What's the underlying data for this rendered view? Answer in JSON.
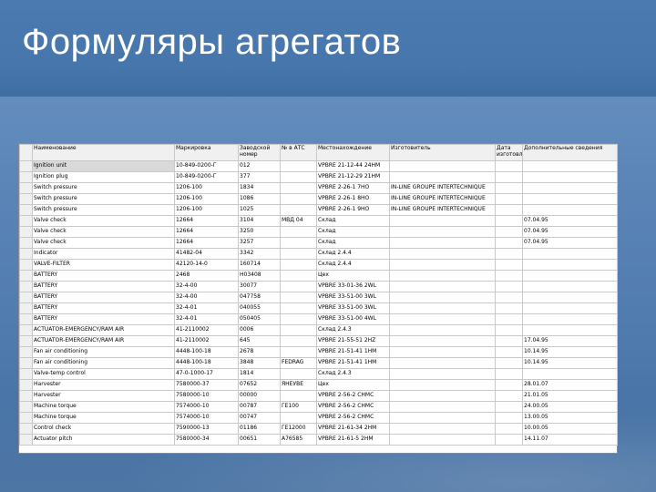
{
  "slide": {
    "title": "Формуляры агрегатов"
  },
  "table": {
    "headers": [
      "Наименование",
      "Маркировка",
      "Заводской номер",
      "№ в АТС",
      "Местонахождение",
      "Изготовитель",
      "Дата изготовления",
      "Дополнительные сведения"
    ],
    "rows": [
      [
        "Ignition unit",
        "10-849-0200-Г",
        "012",
        "",
        "VPBRE 21-12-44 24HM",
        "",
        "",
        ""
      ],
      [
        "Ignition plug",
        "10-849-0200-Г",
        "377",
        "",
        "VPBRE 21-12-29 21HM",
        "",
        "",
        ""
      ],
      [
        "Switch pressure",
        "1206-100",
        "1834",
        "",
        "VPBRE 2-26-1 7HO",
        "IN-LINE GROUPE INTERTECHNIQUE",
        "",
        ""
      ],
      [
        "Switch pressure",
        "1206-100",
        "1086",
        "",
        "VPBRE 2-26-1 8HO",
        "IN-LINE GROUPE INTERTECHNIQUE",
        "",
        ""
      ],
      [
        "Switch pressure",
        "1206-100",
        "1025",
        "",
        "VPBRE 2-26-1 9HO",
        "IN-LINE GROUPE INTERTECHNIQUE",
        "",
        ""
      ],
      [
        "Valve check",
        "12664",
        "3104",
        "МВД 04",
        "Склад",
        "",
        "",
        "07.04.95"
      ],
      [
        "Valve check",
        "12664",
        "3250",
        "",
        "Склад",
        "",
        "",
        "07.04.95"
      ],
      [
        "Valve check",
        "12664",
        "3257",
        "",
        "Склад",
        "",
        "",
        "07.04.95"
      ],
      [
        "Indicator",
        "41482-04",
        "3342",
        "",
        "Склад 2.4.4",
        "",
        "",
        ""
      ],
      [
        "VALVE-FILTER",
        "42120-14-0",
        "160714",
        "",
        "Склад 2.4.4",
        "",
        "",
        ""
      ],
      [
        "BATTERY",
        "2468",
        "H03408",
        "",
        "Цех",
        "",
        "",
        ""
      ],
      [
        "BATTERY",
        "32-4-00",
        "30077",
        "",
        "VPBRE 33-01-36 2WL",
        "",
        "",
        ""
      ],
      [
        "BATTERY",
        "32-4-00",
        "047758",
        "",
        "VPBRE 33-51-00 3WL",
        "",
        "",
        ""
      ],
      [
        "BATTERY",
        "32-4-01",
        "040055",
        "",
        "VPBRE 33-51-00 3WL",
        "",
        "",
        ""
      ],
      [
        "BATTERY",
        "32-4-01",
        "050405",
        "",
        "VPBRE 33-51-00 4WL",
        "",
        "",
        ""
      ],
      [
        "ACTUATOR-EMERGENCY/RAM AIR",
        "41-2110002",
        "0006",
        "",
        "Склад 2.4.3",
        "",
        "",
        ""
      ],
      [
        "ACTUATOR-EMERGENCY/RAM AIR",
        "41-2110002",
        "645",
        "",
        "VPBRE 21-55-51 2HZ",
        "",
        "",
        "17.04.95"
      ],
      [
        "Fan air conditioning",
        "4448-100-18",
        "2678",
        "",
        "VPBRE 21-51-41 1HM",
        "",
        "",
        "10.14.95"
      ],
      [
        "Fan air conditioning",
        "4448-100-18",
        "3848",
        "FEDRAG",
        "VPBRE 21-51-41 1HM",
        "",
        "",
        "10.14.95"
      ],
      [
        "Valve-temp control",
        "47-0-1000-17",
        "1814",
        "",
        "Склад 2.4.3",
        "",
        "",
        ""
      ],
      [
        "Harvester",
        "7580000-37",
        "07652",
        "ЯНЕУВЕ",
        "Цех",
        "",
        "",
        "28.01.07"
      ],
      [
        "Harvester",
        "7580000-10",
        "00000",
        "",
        "VPBRE 2-56-2 СНМС",
        "",
        "",
        "21.01.05"
      ],
      [
        "Machine torque",
        "7574000-10",
        "00787",
        "ГЕ100",
        "VPBRE 2-56-2 СНМС",
        "",
        "",
        "24.00.05"
      ],
      [
        "Machine torque",
        "7574000-10",
        "00747",
        "",
        "VPBRE 2-56-2 СНМС",
        "",
        "",
        "13.00.05"
      ],
      [
        "Control check",
        "7590000-13",
        "01186",
        "ГЕ12000",
        "VPBRE 21-61-34 2HM",
        "",
        "",
        "10.00.05"
      ],
      [
        "Actuator pitch",
        "7580000-34",
        "00651",
        "А76585",
        "VPBRE 21-61-5 2HM",
        "",
        "",
        "14.11.07"
      ]
    ]
  },
  "colors": {
    "background": "#5c86b8",
    "title_band": "#4676ab",
    "title_text": "#ffffff",
    "table_header": "#f0f0f0",
    "selected_row": "#d9d9d9"
  }
}
